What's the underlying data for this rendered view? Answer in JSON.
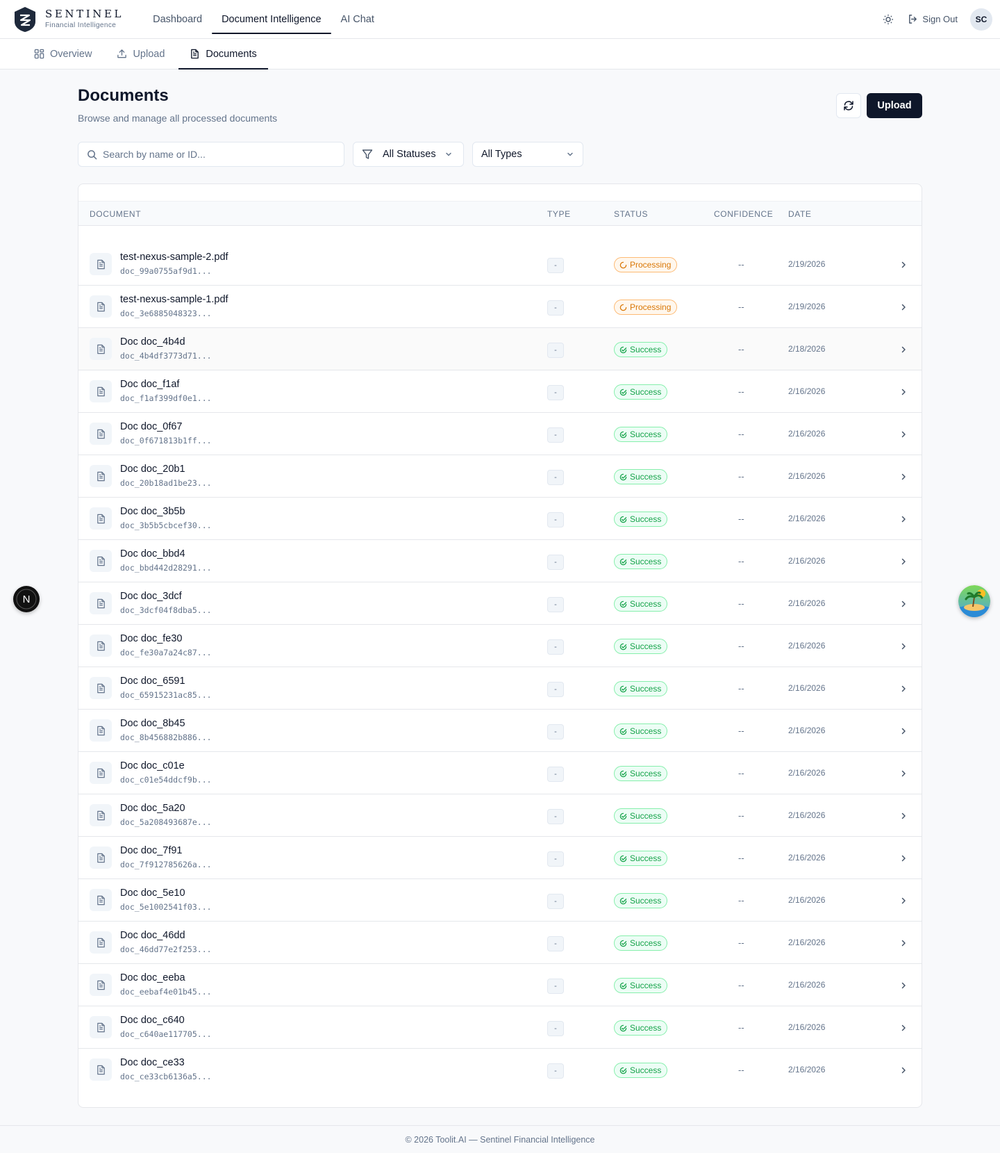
{
  "app": {
    "brand_name": "SENTINEL",
    "brand_sub": "Financial Intelligence",
    "nav": [
      {
        "label": "Dashboard",
        "active": false
      },
      {
        "label": "Document Intelligence",
        "active": true
      },
      {
        "label": "AI Chat",
        "active": false
      }
    ],
    "signout_label": "Sign Out",
    "user_initials": "SC"
  },
  "subnav": {
    "tabs": [
      {
        "label": "Overview",
        "icon": "grid-icon",
        "active": false
      },
      {
        "label": "Upload",
        "icon": "upload-icon",
        "active": false
      },
      {
        "label": "Documents",
        "icon": "file-icon",
        "active": true
      }
    ]
  },
  "page": {
    "title": "Documents",
    "subtitle": "Browse and manage all processed documents",
    "upload_label": "Upload"
  },
  "filters": {
    "search_placeholder": "Search by name or ID...",
    "status_value": "All Statuses",
    "type_value": "All Types"
  },
  "table": {
    "headers": {
      "document": "DOCUMENT",
      "type": "TYPE",
      "status": "STATUS",
      "confidence": "CONFIDENCE",
      "date": "DATE"
    },
    "rows": [
      {
        "name": "test-nexus-sample-2.pdf",
        "id": "doc_99a0755af9d1...",
        "type": "-",
        "status": "Processing",
        "status_kind": "processing",
        "confidence": "--",
        "date": "2/19/2026"
      },
      {
        "name": "test-nexus-sample-1.pdf",
        "id": "doc_3e6885048323...",
        "type": "-",
        "status": "Processing",
        "status_kind": "processing",
        "confidence": "--",
        "date": "2/19/2026"
      },
      {
        "name": "Doc doc_4b4d",
        "id": "doc_4b4df3773d71...",
        "type": "-",
        "status": "Success",
        "status_kind": "success",
        "confidence": "--",
        "date": "2/18/2026"
      },
      {
        "name": "Doc doc_f1af",
        "id": "doc_f1af399df0e1...",
        "type": "-",
        "status": "Success",
        "status_kind": "success",
        "confidence": "--",
        "date": "2/16/2026"
      },
      {
        "name": "Doc doc_0f67",
        "id": "doc_0f671813b1ff...",
        "type": "-",
        "status": "Success",
        "status_kind": "success",
        "confidence": "--",
        "date": "2/16/2026"
      },
      {
        "name": "Doc doc_20b1",
        "id": "doc_20b18ad1be23...",
        "type": "-",
        "status": "Success",
        "status_kind": "success",
        "confidence": "--",
        "date": "2/16/2026"
      },
      {
        "name": "Doc doc_3b5b",
        "id": "doc_3b5b5cbcef30...",
        "type": "-",
        "status": "Success",
        "status_kind": "success",
        "confidence": "--",
        "date": "2/16/2026"
      },
      {
        "name": "Doc doc_bbd4",
        "id": "doc_bbd442d28291...",
        "type": "-",
        "status": "Success",
        "status_kind": "success",
        "confidence": "--",
        "date": "2/16/2026"
      },
      {
        "name": "Doc doc_3dcf",
        "id": "doc_3dcf04f8dba5...",
        "type": "-",
        "status": "Success",
        "status_kind": "success",
        "confidence": "--",
        "date": "2/16/2026"
      },
      {
        "name": "Doc doc_fe30",
        "id": "doc_fe30a7a24c87...",
        "type": "-",
        "status": "Success",
        "status_kind": "success",
        "confidence": "--",
        "date": "2/16/2026"
      },
      {
        "name": "Doc doc_6591",
        "id": "doc_65915231ac85...",
        "type": "-",
        "status": "Success",
        "status_kind": "success",
        "confidence": "--",
        "date": "2/16/2026"
      },
      {
        "name": "Doc doc_8b45",
        "id": "doc_8b456882b886...",
        "type": "-",
        "status": "Success",
        "status_kind": "success",
        "confidence": "--",
        "date": "2/16/2026"
      },
      {
        "name": "Doc doc_c01e",
        "id": "doc_c01e54ddcf9b...",
        "type": "-",
        "status": "Success",
        "status_kind": "success",
        "confidence": "--",
        "date": "2/16/2026"
      },
      {
        "name": "Doc doc_5a20",
        "id": "doc_5a208493687e...",
        "type": "-",
        "status": "Success",
        "status_kind": "success",
        "confidence": "--",
        "date": "2/16/2026"
      },
      {
        "name": "Doc doc_7f91",
        "id": "doc_7f912785626a...",
        "type": "-",
        "status": "Success",
        "status_kind": "success",
        "confidence": "--",
        "date": "2/16/2026"
      },
      {
        "name": "Doc doc_5e10",
        "id": "doc_5e1002541f03...",
        "type": "-",
        "status": "Success",
        "status_kind": "success",
        "confidence": "--",
        "date": "2/16/2026"
      },
      {
        "name": "Doc doc_46dd",
        "id": "doc_46dd77e2f253...",
        "type": "-",
        "status": "Success",
        "status_kind": "success",
        "confidence": "--",
        "date": "2/16/2026"
      },
      {
        "name": "Doc doc_eeba",
        "id": "doc_eebaf4e01b45...",
        "type": "-",
        "status": "Success",
        "status_kind": "success",
        "confidence": "--",
        "date": "2/16/2026"
      },
      {
        "name": "Doc doc_c640",
        "id": "doc_c640ae117705...",
        "type": "-",
        "status": "Success",
        "status_kind": "success",
        "confidence": "--",
        "date": "2/16/2026"
      },
      {
        "name": "Doc doc_ce33",
        "id": "doc_ce33cb6136a5...",
        "type": "-",
        "status": "Success",
        "status_kind": "success",
        "confidence": "--",
        "date": "2/16/2026"
      }
    ]
  },
  "footer": {
    "text": "© 2026 Toolit.AI — Sentinel Financial Intelligence"
  },
  "floating": {
    "left_badge_letter": "N"
  },
  "colors": {
    "primary": "#0f172a",
    "processing": "#d97706",
    "success": "#16a34a",
    "muted": "#64748b"
  }
}
